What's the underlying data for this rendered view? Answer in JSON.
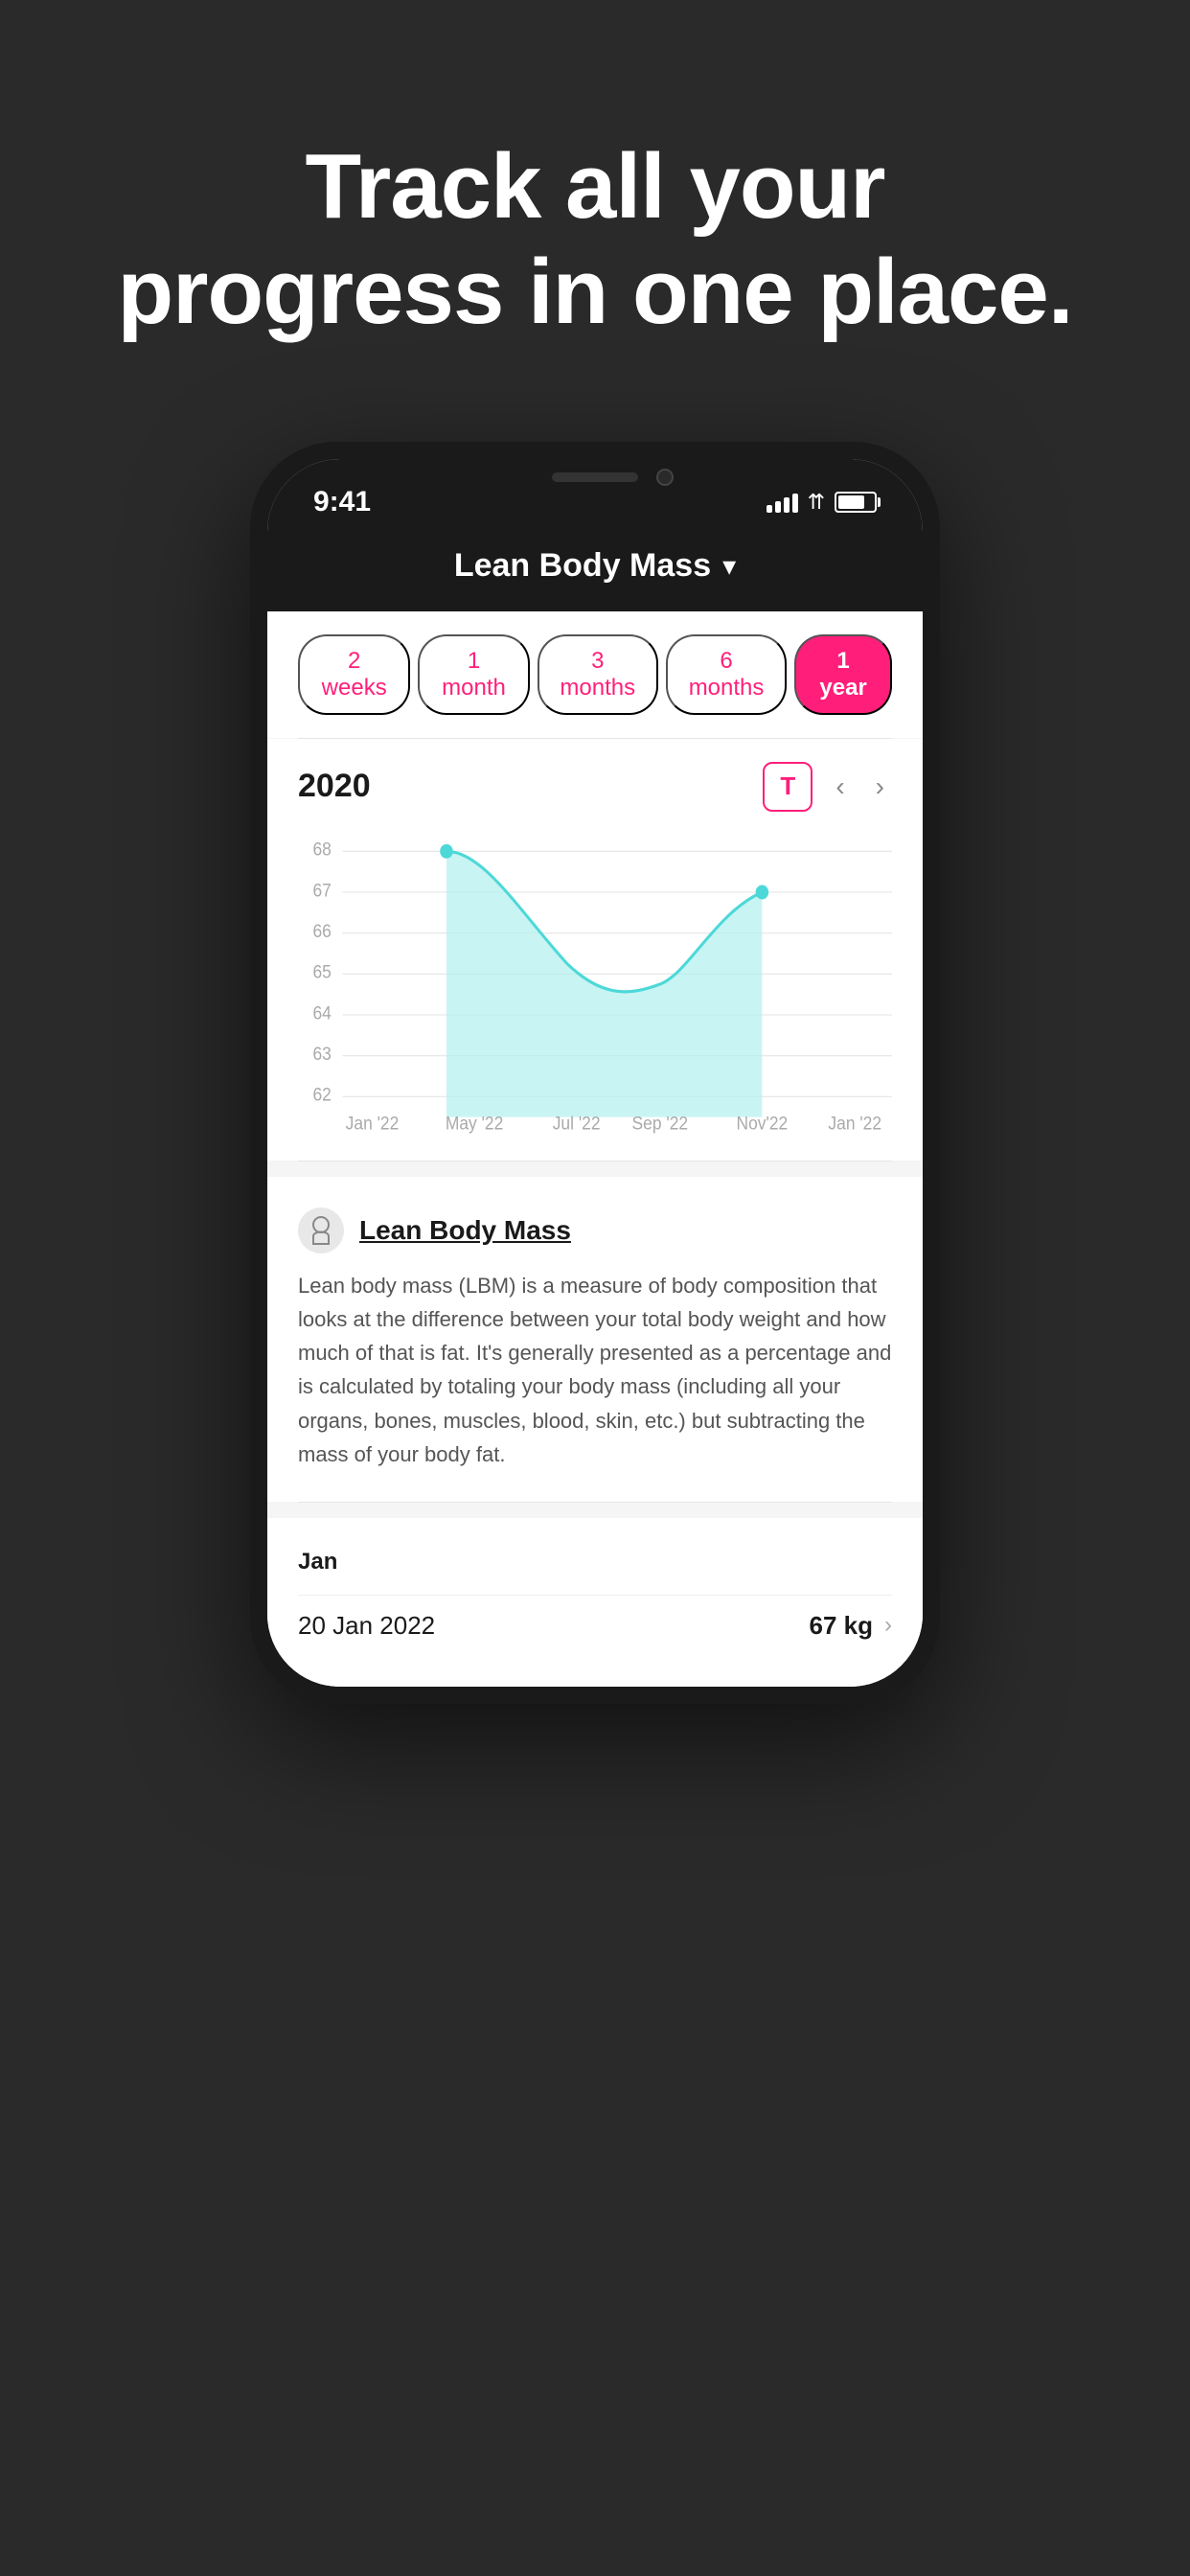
{
  "hero": {
    "text": "Track all your progress in one place."
  },
  "status_bar": {
    "time": "9:41"
  },
  "app_header": {
    "title": "Lean Body Mass",
    "chevron": "▾"
  },
  "time_filters": {
    "items": [
      {
        "label": "2 weeks",
        "active": false
      },
      {
        "label": "1 month",
        "active": false
      },
      {
        "label": "3 months",
        "active": false
      },
      {
        "label": "6 months",
        "active": false
      },
      {
        "label": "1 year",
        "active": true
      }
    ]
  },
  "chart": {
    "year": "2020",
    "y_labels": [
      "68",
      "67",
      "66",
      "65",
      "64",
      "63",
      "62"
    ],
    "x_labels": [
      "Jan '22",
      "May '22",
      "Jul '22",
      "Sep '22",
      "Nov'22",
      "Jan '22"
    ],
    "accent_color": "#7ee8e8"
  },
  "info": {
    "icon": "🔵",
    "title": "Lean Body Mass",
    "body": "Lean body mass (LBM) is a measure of body composition that looks at the difference between your total body weight and how much of that is fat. It's generally presented as a percentage and is calculated by totaling your body mass (including all your organs, bones, muscles, blood, skin, etc.) but subtracting the mass of your body fat."
  },
  "records": {
    "month": "Jan",
    "entries": [
      {
        "date": "20 Jan 2022",
        "value": "67 kg"
      }
    ]
  },
  "colors": {
    "accent": "#ff1f7a",
    "chart_fill": "#b2f0f0",
    "chart_stroke": "#4dd8d8",
    "dark_bg": "#1a1a1a"
  }
}
